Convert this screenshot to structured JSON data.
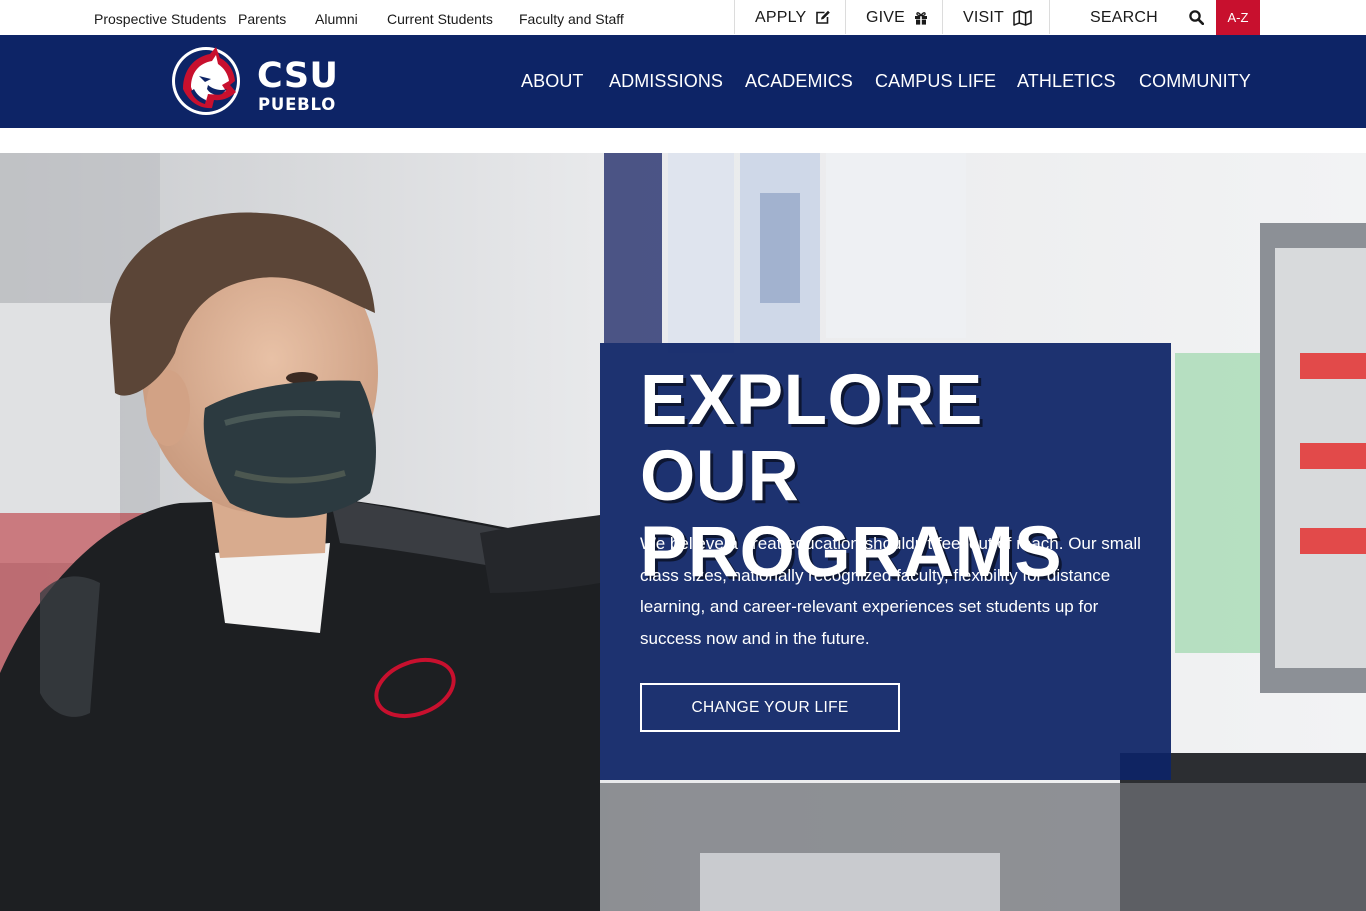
{
  "utility_bar": {
    "audience_links": [
      "Prospective Students",
      "Parents",
      "Alumni",
      "Current Students",
      "Faculty and Staff"
    ],
    "apply_label": "APPLY",
    "give_label": "GIVE",
    "visit_label": "VISIT",
    "search_label": "SEARCH",
    "az_label": "A-Z"
  },
  "brand": {
    "logo_line1": "CSU",
    "logo_line2": "PUEBLO",
    "navy": "#0d2466",
    "red": "#c8102e"
  },
  "main_nav": {
    "items": [
      "ABOUT",
      "ADMISSIONS",
      "ACADEMICS",
      "CAMPUS LIFE",
      "ATHLETICS",
      "COMMUNITY"
    ]
  },
  "hero": {
    "headline": "EXPLORE OUR PROGRAMS",
    "body": "We believe a great education shouldn't feel out of reach. Our small class sizes, nationally recognized faculty, flexibility for distance learning, and career-relevant experiences set students up for success now and in the future.",
    "cta_label": "CHANGE YOUR LIFE"
  },
  "icons": {
    "apply": "edit-icon",
    "give": "gift-icon",
    "visit": "map-icon",
    "search": "search-icon",
    "logo": "thunderwolf-mascot-icon"
  }
}
